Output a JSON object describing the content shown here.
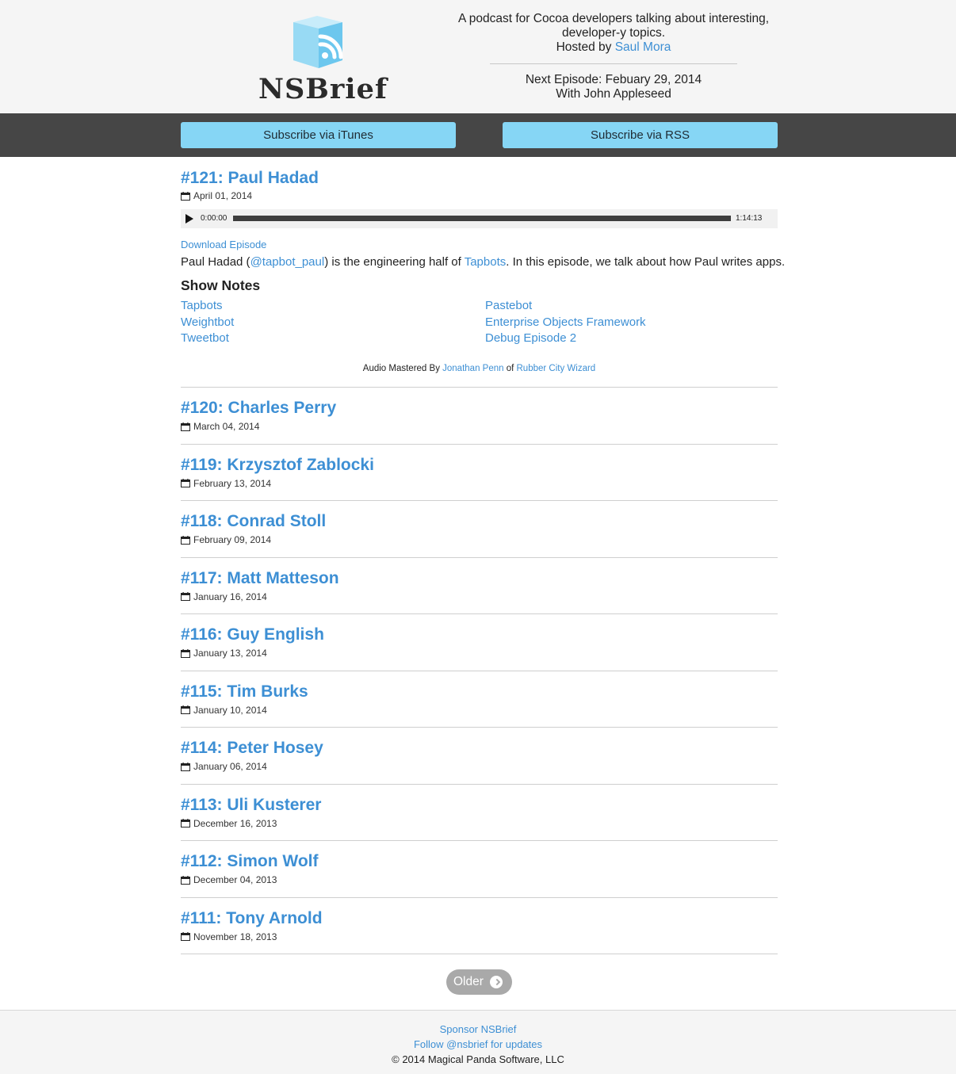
{
  "header": {
    "logo_text": "NSBrief",
    "tagline_line1": "A podcast for Cocoa developers talking about interesting,",
    "tagline_line2": "developer-y topics.",
    "hosted_by_label": "Hosted by ",
    "host_name": "Saul Mora",
    "next_episode": "Next Episode: Febuary 29, 2014",
    "next_episode_guest": "With John Appleseed"
  },
  "subscribe": {
    "itunes_label": "Subscribe via iTunes",
    "rss_label": "Subscribe via RSS"
  },
  "featured": {
    "title": "#121: Paul Hadad",
    "date": "April 01, 2014",
    "player": {
      "current_time": "0:00:00",
      "total_time": "1:14:13",
      "progress_fraction": 0.0
    },
    "download_label": "Download Episode",
    "description": {
      "part1": "Paul Hadad (",
      "twitter": "@tapbot_paul",
      "part2": ") is the engineering half of ",
      "company": "Tapbots",
      "part3": ". In this episode, we talk about how Paul writes apps."
    },
    "show_notes_heading": "Show Notes",
    "show_notes_left": [
      "Tapbots",
      "Weightbot",
      "Tweetbot"
    ],
    "show_notes_right": [
      "Pastebot",
      "Enterprise Objects Framework",
      "Debug Episode 2"
    ],
    "mastered": {
      "prefix": "Audio Mastered By ",
      "engineer": "Jonathan Penn",
      "middle": " of ",
      "studio": "Rubber City Wizard"
    }
  },
  "episodes": [
    {
      "title": "#120: Charles Perry",
      "date": "March 04, 2014"
    },
    {
      "title": "#119: Krzysztof Zablocki",
      "date": "February 13, 2014"
    },
    {
      "title": "#118: Conrad Stoll",
      "date": "February 09, 2014"
    },
    {
      "title": "#117: Matt Matteson",
      "date": "January 16, 2014"
    },
    {
      "title": "#116: Guy English",
      "date": "January 13, 2014"
    },
    {
      "title": "#115: Tim Burks",
      "date": "January 10, 2014"
    },
    {
      "title": "#114: Peter Hosey",
      "date": "January 06, 2014"
    },
    {
      "title": "#113: Uli Kusterer",
      "date": "December 16, 2013"
    },
    {
      "title": "#112: Simon Wolf",
      "date": "December 04, 2013"
    },
    {
      "title": "#111: Tony Arnold",
      "date": "November 18, 2013"
    }
  ],
  "pagination": {
    "older_label": "Older"
  },
  "footer": {
    "sponsor_label": "Sponsor NSBrief",
    "follow_label": "Follow @nsbrief for updates",
    "copyright": "© 2014 Magical Panda Software, LLC"
  },
  "colors": {
    "link": "#3d8fd4",
    "subscribe_button": "#86d6f5",
    "subscribe_bar": "#464646",
    "header_bg": "#f5f5f5"
  },
  "icons": [
    "rss-cube-logo-icon",
    "calendar-icon",
    "play-icon",
    "chevron-right-icon"
  ]
}
